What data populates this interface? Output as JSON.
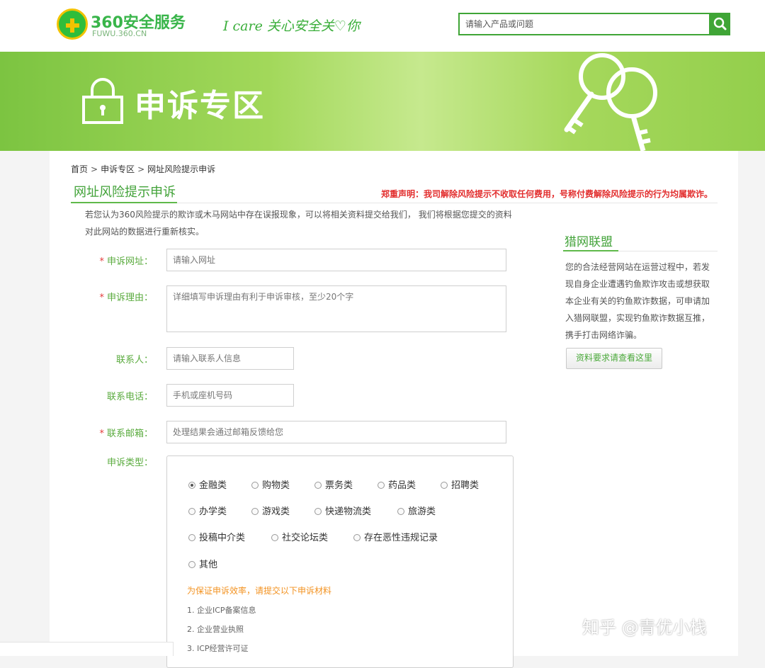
{
  "header": {
    "logo_title": "360安全服务",
    "logo_sub": "FUWU.360.CN",
    "slogan": "I care 关心安全关♡你",
    "search_placeholder": "请输入产品或问题"
  },
  "banner": {
    "title": "申诉专区"
  },
  "breadcrumb": [
    "首页",
    "申诉专区",
    "网址风险提示申诉"
  ],
  "breadcrumb_sep": ">",
  "form_section": {
    "title": "网址风险提示申诉",
    "notice": "郑重声明：我司解除风险提示不收取任何费用，号称付费解除风险提示的行为均属欺诈。",
    "intro": "若您认为360风险提示的欺诈或木马网站中存在误报现象，可以将相关资料提交给我们， 我们将根据您提交的资料对此网站的数据进行重新核实。"
  },
  "form": {
    "required_mark": "*",
    "url": {
      "label": "申诉网址：",
      "placeholder": "请输入网址"
    },
    "reason": {
      "label": "申诉理由：",
      "placeholder": "详细填写申诉理由有利于申诉审核，至少20个字"
    },
    "contact": {
      "label": "联系人：",
      "placeholder": "请输入联系人信息"
    },
    "phone": {
      "label": "联系电话：",
      "placeholder": "手机或座机号码"
    },
    "email": {
      "label": "联系邮箱：",
      "placeholder": "处理结果会通过邮箱反馈给您"
    },
    "type_label": "申诉类型：",
    "types": [
      "金融类",
      "购物类",
      "票务类",
      "药品类",
      "招聘类",
      "办学类",
      "游戏类",
      "快递物流类",
      "旅游类",
      "投稿中介类",
      "社交论坛类",
      "存在恶性违规记录",
      "其他"
    ],
    "selected_type": "金融类",
    "materials_head": "为保证申诉效率，请提交以下申诉材料",
    "materials": [
      "1. 企业ICP备案信息",
      "2. 企业营业执照",
      "3. ICP经营许可证"
    ]
  },
  "sidebar": {
    "title": "猎网联盟",
    "text": "您的合法经营网站在运营过程中，若发现自身企业遭遇钓鱼欺诈攻击或想获取本企业有关的钓鱼欺诈数据，可申请加入猎网联盟，实现钓鱼欺诈数据互推，携手打击网络诈骗。",
    "button": "资料要求请查看这里"
  },
  "watermark": "知乎 @青优小栈",
  "colors": {
    "brand_green": "#43a33a",
    "notice_red": "#e22d2d",
    "materials_orange": "#f39322"
  }
}
